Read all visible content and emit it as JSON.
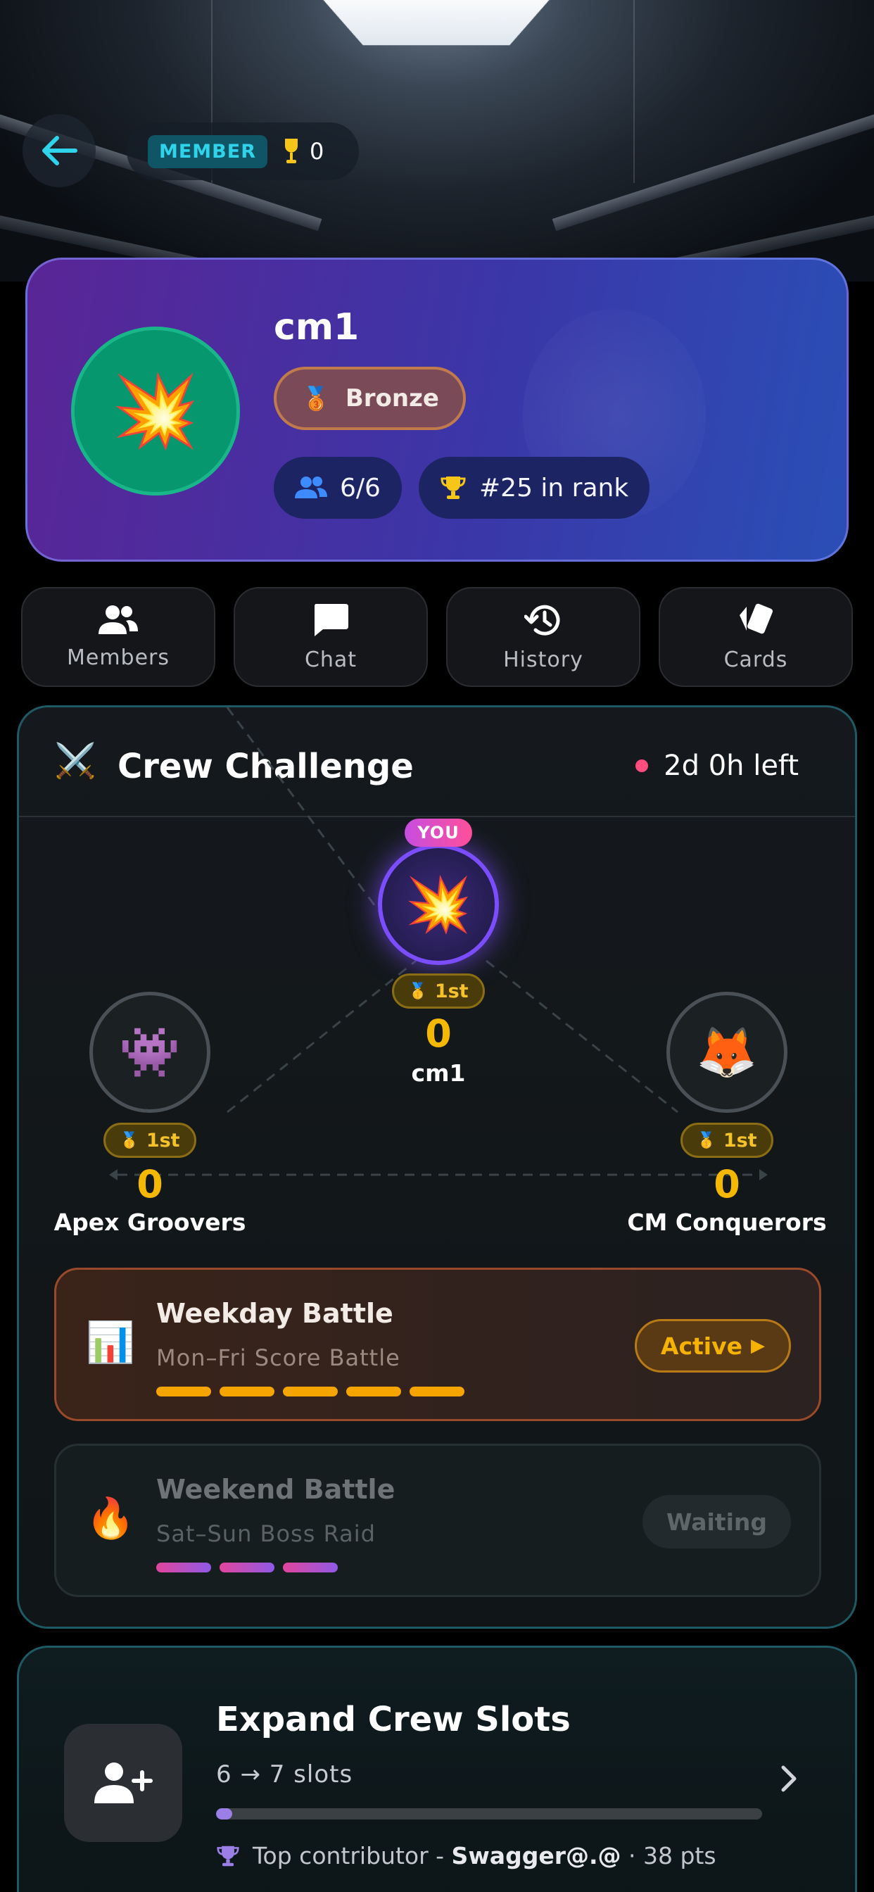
{
  "header": {
    "member_label": "MEMBER",
    "trophy_count": "0"
  },
  "profile": {
    "crew_name": "cm1",
    "avatar_emoji": "💥",
    "rank_medal_emoji": "🥉",
    "rank_label": "Bronze",
    "members_count": "6/6",
    "rank_position": "#25 in rank"
  },
  "tabs": [
    {
      "label": "Members",
      "icon": "members-icon"
    },
    {
      "label": "Chat",
      "icon": "chat-icon"
    },
    {
      "label": "History",
      "icon": "history-icon"
    },
    {
      "label": "Cards",
      "icon": "cards-icon"
    }
  ],
  "challenge": {
    "icon_emoji": "⚔️",
    "title": "Crew Challenge",
    "time_left": "2d 0h left",
    "you_badge": "YOU",
    "teams": [
      {
        "name": "cm1",
        "emoji": "💥",
        "medal": "🥇",
        "place": "1st",
        "score": "0",
        "is_you": true
      },
      {
        "name": "Apex Groovers",
        "emoji": "👾",
        "medal": "🥇",
        "place": "1st",
        "score": "0",
        "is_you": false
      },
      {
        "name": "CM Conquerors",
        "emoji": "🦊",
        "medal": "🥇",
        "place": "1st",
        "score": "0",
        "is_you": false
      }
    ],
    "battles": [
      {
        "title": "Weekday Battle",
        "subtitle": "Mon–Fri Score Battle",
        "emoji": "📊",
        "status": "Active",
        "status_icon": "▶",
        "segments": 5
      },
      {
        "title": "Weekend Battle",
        "subtitle": "Sat–Sun Boss Raid",
        "emoji": "🔥",
        "status": "Waiting",
        "segments": 3
      }
    ]
  },
  "expand": {
    "title": "Expand Crew Slots",
    "slots_text": "6 → 7 slots",
    "progress": 0.03,
    "contributor_prefix": "Top contributor - ",
    "contributor_name": "Swagger@.@",
    "contributor_suffix": " · 38 pts"
  },
  "colors": {
    "accent_cyan": "#2fd3ea",
    "gold": "#f5b800",
    "bronze_border": "#c17a4c",
    "you_purple": "#7c4dff",
    "timer_dot": "#ff4d7d"
  }
}
